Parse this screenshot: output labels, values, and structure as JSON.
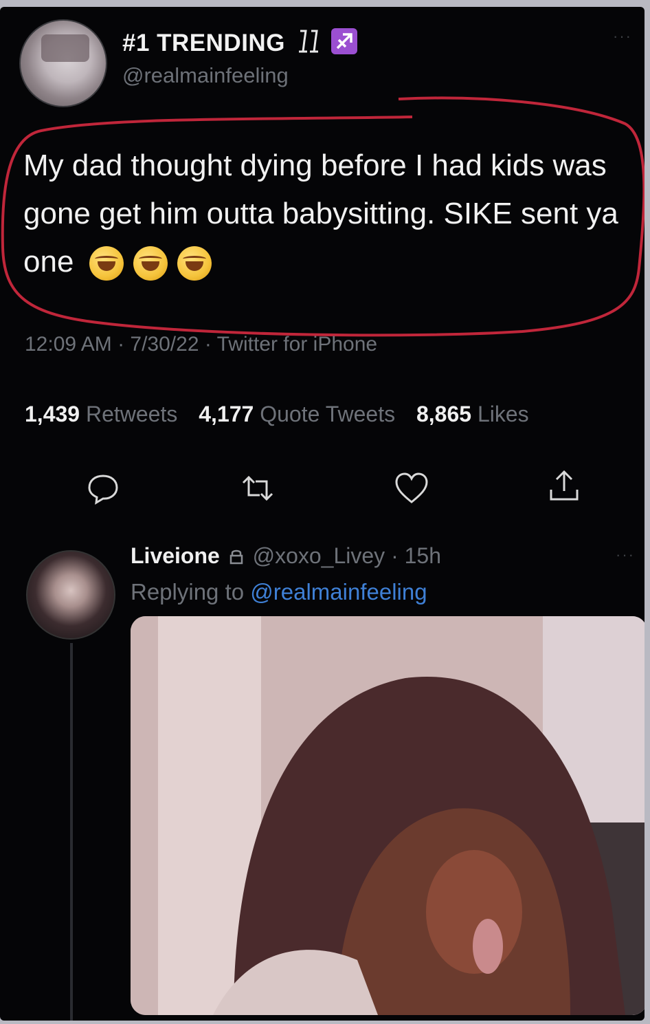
{
  "tweet": {
    "display_name": "#1 TRENDING",
    "handle": "@realmainfeeling",
    "more": "···",
    "text": "My dad thought dying before I had kids was gone get him outta babysitting. SIKE sent ya one",
    "emojis": [
      "rolling-on-floor-laughing-emoji",
      "rolling-on-floor-laughing-emoji",
      "rolling-on-floor-laughing-emoji"
    ],
    "meta": "12:09 AM · 7/30/22 · Twitter for iPhone",
    "stats": {
      "retweets_count": "1,439",
      "retweets_label": "Retweets",
      "quotes_count": "4,177",
      "quotes_label": "Quote Tweets",
      "likes_count": "8,865",
      "likes_label": "Likes"
    },
    "actions": [
      "reply-icon",
      "retweet-icon",
      "like-icon",
      "share-icon"
    ]
  },
  "reply": {
    "display_name": "Liveione",
    "handle_time": "@xoxo_Livey · 15h",
    "replying_prefix": "Replying to",
    "replying_mention": "@realmainfeeling",
    "more": "···"
  },
  "colors": {
    "background": "#050507",
    "text": "#f1f1f1",
    "muted": "#6e7279",
    "link": "#3f80d6",
    "highlight_circle": "#c0263a"
  }
}
